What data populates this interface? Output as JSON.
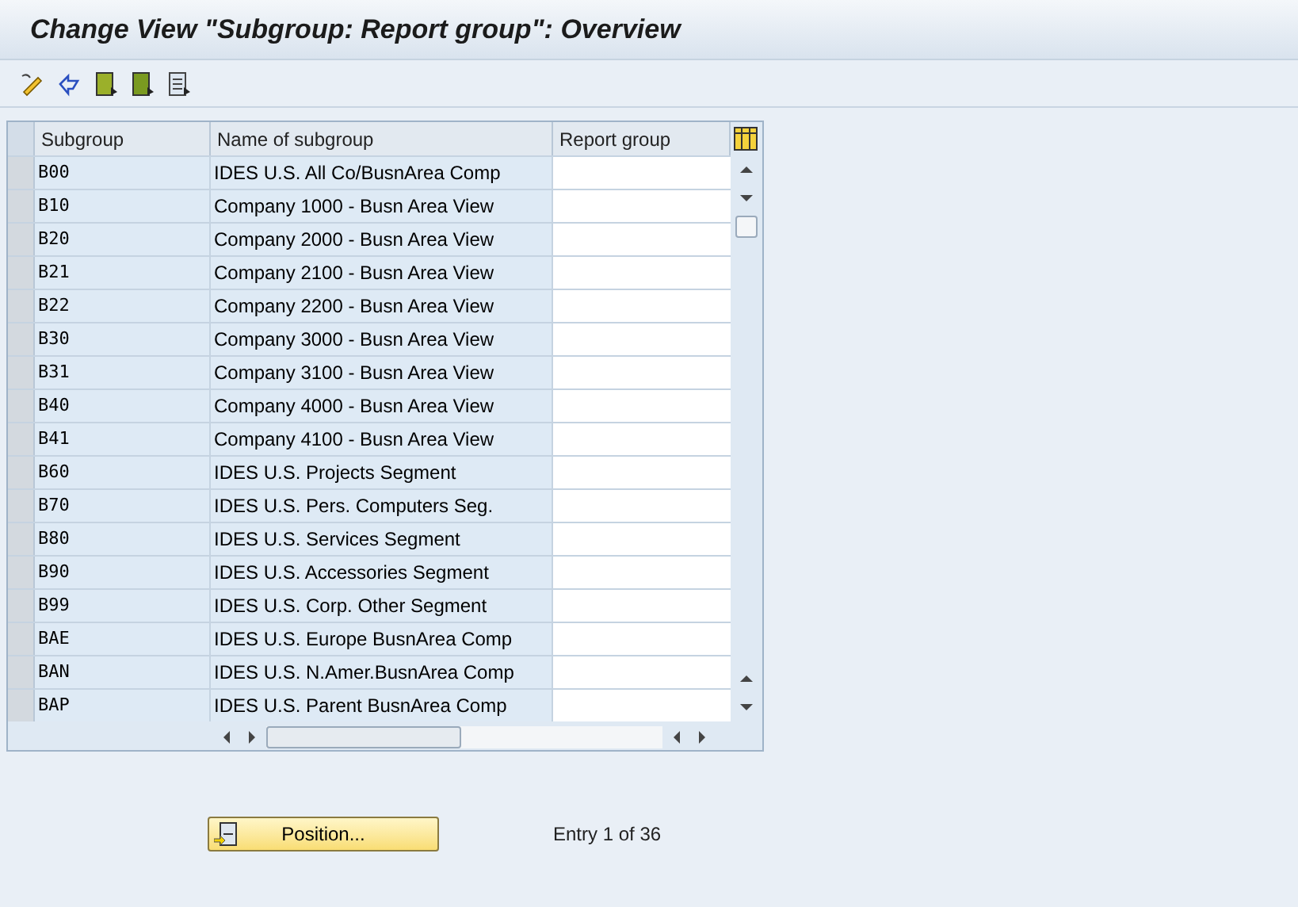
{
  "window": {
    "title": "Change View \"Subgroup: Report group\": Overview"
  },
  "table": {
    "columns": [
      "Subgroup",
      "Name of subgroup",
      "Report group"
    ],
    "rows": [
      {
        "subgroup": "B00",
        "name": "IDES U.S. All Co/BusnArea Comp",
        "report_group": ""
      },
      {
        "subgroup": "B10",
        "name": "Company 1000 - Busn Area View",
        "report_group": ""
      },
      {
        "subgroup": "B20",
        "name": "Company 2000 - Busn Area View",
        "report_group": ""
      },
      {
        "subgroup": "B21",
        "name": "Company 2100 - Busn Area View",
        "report_group": ""
      },
      {
        "subgroup": "B22",
        "name": "Company 2200 - Busn Area View",
        "report_group": ""
      },
      {
        "subgroup": "B30",
        "name": "Company 3000 - Busn Area View",
        "report_group": ""
      },
      {
        "subgroup": "B31",
        "name": "Company 3100 - Busn Area View",
        "report_group": ""
      },
      {
        "subgroup": "B40",
        "name": "Company 4000 - Busn Area View",
        "report_group": ""
      },
      {
        "subgroup": "B41",
        "name": "Company 4100 - Busn Area View",
        "report_group": ""
      },
      {
        "subgroup": "B60",
        "name": "IDES U.S. Projects Segment",
        "report_group": ""
      },
      {
        "subgroup": "B70",
        "name": "IDES U.S. Pers. Computers Seg.",
        "report_group": ""
      },
      {
        "subgroup": "B80",
        "name": "IDES U.S. Services Segment",
        "report_group": ""
      },
      {
        "subgroup": "B90",
        "name": "IDES U.S. Accessories Segment",
        "report_group": ""
      },
      {
        "subgroup": "B99",
        "name": "IDES U.S. Corp. Other Segment",
        "report_group": ""
      },
      {
        "subgroup": "BAE",
        "name": "IDES U.S. Europe BusnArea Comp",
        "report_group": ""
      },
      {
        "subgroup": "BAN",
        "name": "IDES U.S. N.Amer.BusnArea Comp",
        "report_group": ""
      },
      {
        "subgroup": "BAP",
        "name": "IDES U.S. Parent BusnArea Comp",
        "report_group": ""
      }
    ]
  },
  "position_button": {
    "label": "Position..."
  },
  "entry_info": "Entry 1 of 36"
}
